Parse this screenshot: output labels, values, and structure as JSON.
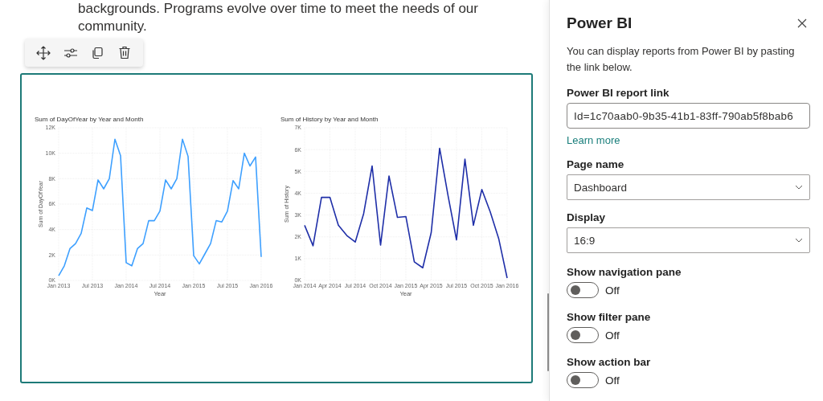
{
  "paragraph": {
    "lines": [
      "backgrounds. Programs evolve over time to meet the needs of our",
      "community."
    ]
  },
  "report": {
    "charts": [
      {
        "chart_data": {
          "type": "line",
          "title": "Sum of DayOfYear by Year and Month",
          "xlabel": "Year",
          "ylabel": "Sum of DayOfYear",
          "categories": [
            "Jan 2013",
            null,
            null,
            null,
            null,
            null,
            "Jul 2013",
            null,
            null,
            null,
            null,
            null,
            "Jan 2014",
            null,
            null,
            null,
            null,
            null,
            "Jul 2014",
            null,
            null,
            null,
            null,
            null,
            "Jan 2015",
            null,
            null,
            null,
            null,
            null,
            "Jul 2015",
            null,
            null,
            null,
            null,
            null,
            "Jan 2016"
          ],
          "series": [
            {
              "color": "#3ea0ff",
              "values": [
                370,
                1150,
                2500,
                2900,
                3700,
                5700,
                5500,
                7900,
                7200,
                8000,
                11100,
                9800,
                1400,
                1150,
                2500,
                2900,
                4700,
                4700,
                5450,
                7900,
                7200,
                8000,
                11100,
                9750,
                1950,
                1300,
                2100,
                2900,
                4700,
                4600,
                5450,
                7850,
                7200,
                10000,
                9000,
                9700,
                1850
              ]
            }
          ],
          "ylim": [
            0,
            12000
          ],
          "grid": true,
          "yticks": [
            {
              "value": 0,
              "label": "0K"
            },
            {
              "value": 2000,
              "label": "2K"
            },
            {
              "value": 4000,
              "label": "4K"
            },
            {
              "value": 6000,
              "label": "6K"
            },
            {
              "value": 8000,
              "label": "8K"
            },
            {
              "value": 10000,
              "label": "10K"
            },
            {
              "value": 12000,
              "label": "12K"
            }
          ]
        }
      },
      {
        "chart_data": {
          "type": "line",
          "title": "Sum of History by Year and Month",
          "xlabel": "Year",
          "ylabel": "Sum of History",
          "categories": [
            "Jan 2014",
            null,
            null,
            "Apr 2014",
            null,
            null,
            "Jul 2014",
            null,
            null,
            "Oct 2014",
            null,
            null,
            "Jan 2015",
            null,
            null,
            "Apr 2015",
            null,
            null,
            "Jul 2015",
            null,
            null,
            "Oct 2015",
            null,
            null,
            "Jan 2016"
          ],
          "series": [
            {
              "color": "#1f2fa8",
              "values": [
                2530,
                1590,
                3810,
                3810,
                2530,
                2060,
                1760,
                3070,
                5250,
                1620,
                4790,
                2890,
                2930,
                850,
                580,
                2190,
                6060,
                3880,
                1860,
                5560,
                2530,
                4170,
                3140,
                1920,
                110
              ]
            }
          ],
          "ylim": [
            0,
            7000
          ],
          "grid": true,
          "yticks": [
            {
              "value": 0,
              "label": "0K"
            },
            {
              "value": 1000,
              "label": "1K"
            },
            {
              "value": 2000,
              "label": "2K"
            },
            {
              "value": 3000,
              "label": "3K"
            },
            {
              "value": 4000,
              "label": "4K"
            },
            {
              "value": 5000,
              "label": "5K"
            },
            {
              "value": 6000,
              "label": "6K"
            },
            {
              "value": 7000,
              "label": "7K"
            }
          ]
        }
      }
    ]
  },
  "panel": {
    "title": "Power BI",
    "description": "You can display reports from Power BI by pasting the link below.",
    "link": {
      "label": "Power BI report link",
      "value": "Id=1c70aab0-9b35-41b1-83ff-790ab5f8bab6"
    },
    "learn_more": "Learn more",
    "page": {
      "label": "Page name",
      "value": "Dashboard"
    },
    "display": {
      "label": "Display",
      "value": "16:9"
    },
    "toggles": [
      {
        "label": "Show navigation pane",
        "on": false,
        "state_text": "Off"
      },
      {
        "label": "Show filter pane",
        "on": false,
        "state_text": "Off"
      },
      {
        "label": "Show action bar",
        "on": false,
        "state_text": "Off"
      }
    ]
  }
}
